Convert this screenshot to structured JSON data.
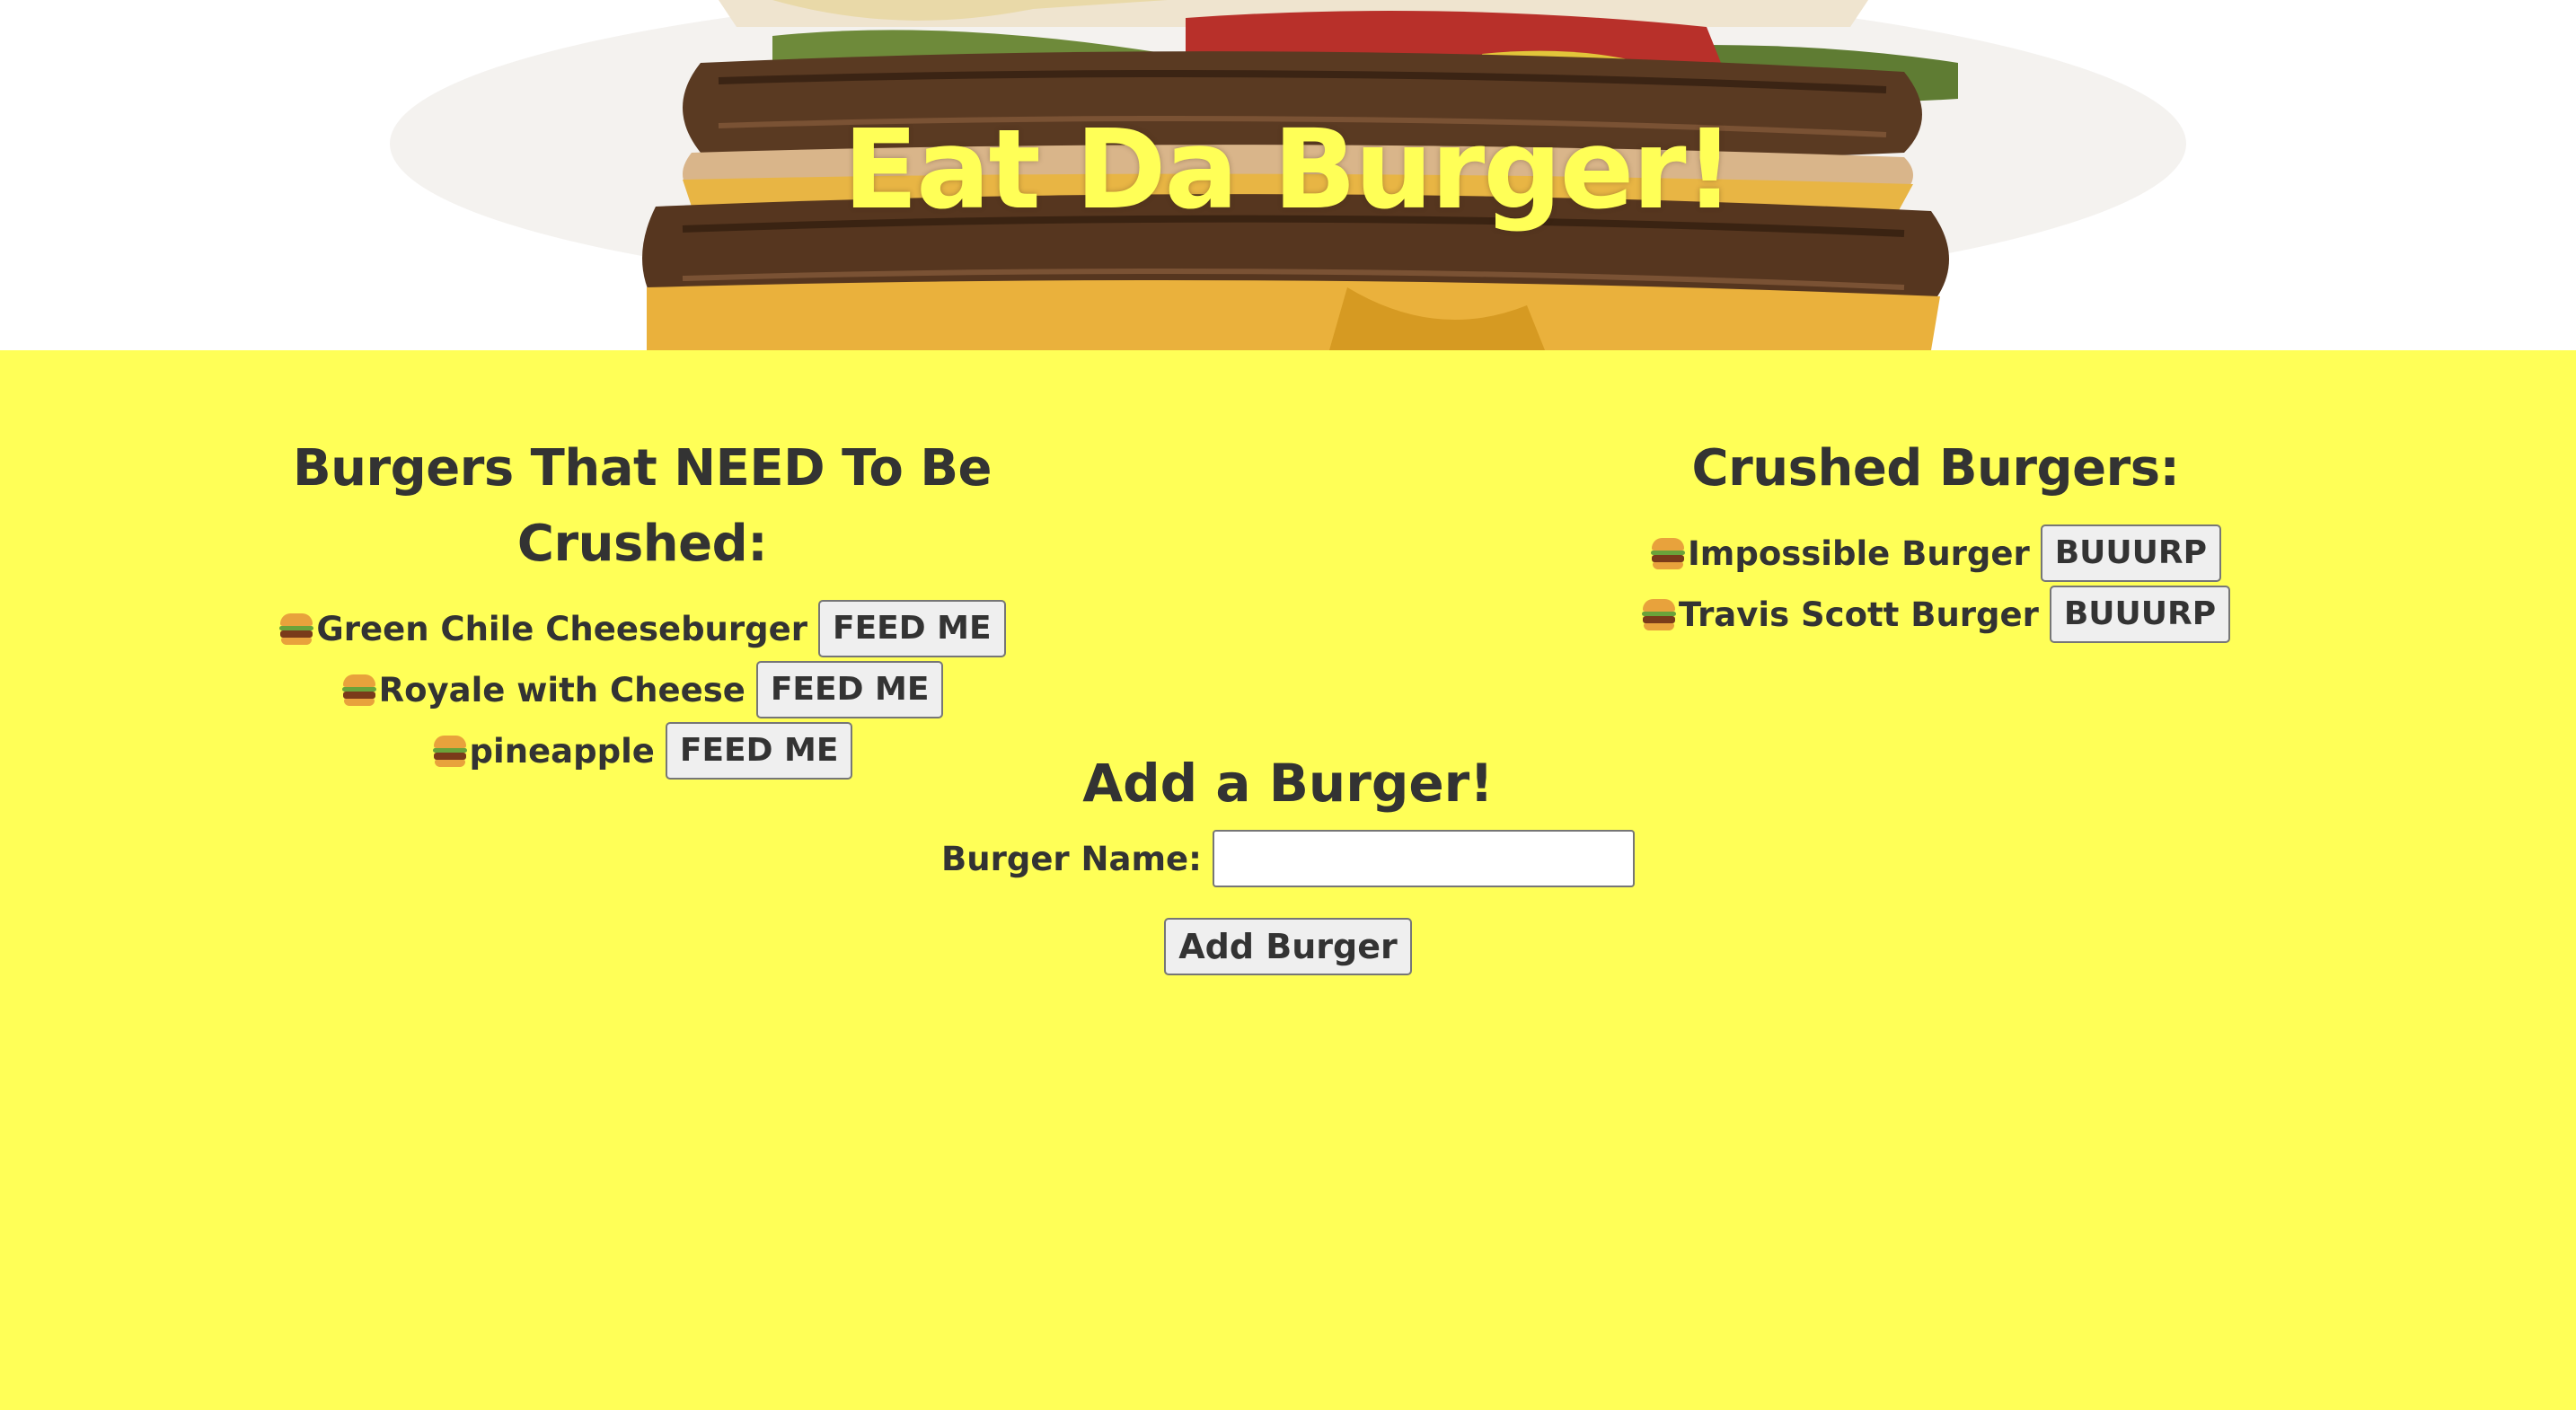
{
  "header": {
    "title": "Eat Da Burger!"
  },
  "uncrushed": {
    "heading": "Burgers That NEED To Be Crushed:",
    "items": [
      {
        "name": "Green Chile Cheeseburger",
        "button": "FEED ME"
      },
      {
        "name": "Royale with Cheese",
        "button": "FEED ME"
      },
      {
        "name": "pineapple",
        "button": "FEED ME"
      }
    ]
  },
  "crushed": {
    "heading": "Crushed Burgers:",
    "items": [
      {
        "name": "Impossible Burger",
        "button": "BUUURP"
      },
      {
        "name": "Travis Scott Burger",
        "button": "BUUURP"
      }
    ]
  },
  "add_form": {
    "heading": "Add a Burger!",
    "label": "Burger Name:",
    "input_value": "",
    "submit_label": "Add Burger"
  },
  "colors": {
    "page_background": "#ffff57",
    "title_color": "#ffff57",
    "text_color": "#333333"
  },
  "icons": {
    "burger": "hamburger-emoji",
    "hero": "burger-photo"
  }
}
